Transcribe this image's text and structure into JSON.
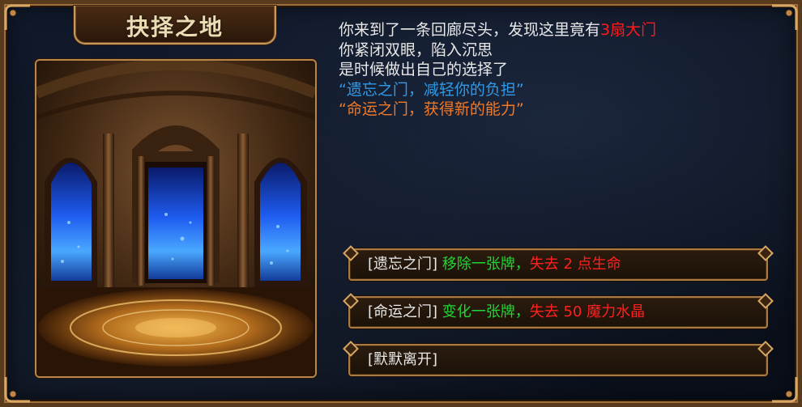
{
  "title": "抉择之地",
  "story": {
    "line1_prefix": "你来到了一条回廊尽头，发现这里竟有",
    "line1_highlight": "3扇大门",
    "line2": "你紧闭双眼，陷入沉思",
    "line3": "是时候做出自己的选择了",
    "line4": "“遗忘之门，减轻你的负担”",
    "line5": "“命运之门，获得新的能力”"
  },
  "options": [
    {
      "name": "[遗忘之门]",
      "effect": "移除一张牌，",
      "cost": "失去 2 点生命"
    },
    {
      "name": "[命运之门]",
      "effect": "变化一张牌，",
      "cost": "失去 50 魔力水晶"
    },
    {
      "name": "[默默离开]"
    }
  ],
  "colors": {
    "highlight_red": "#ff1a1a",
    "quote_blue": "#2f9ae8",
    "quote_orange": "#f07a28",
    "effect_green": "#22d633",
    "frame_gold": "#c79a5c"
  },
  "icons": [
    "ornate-corner-icon"
  ]
}
